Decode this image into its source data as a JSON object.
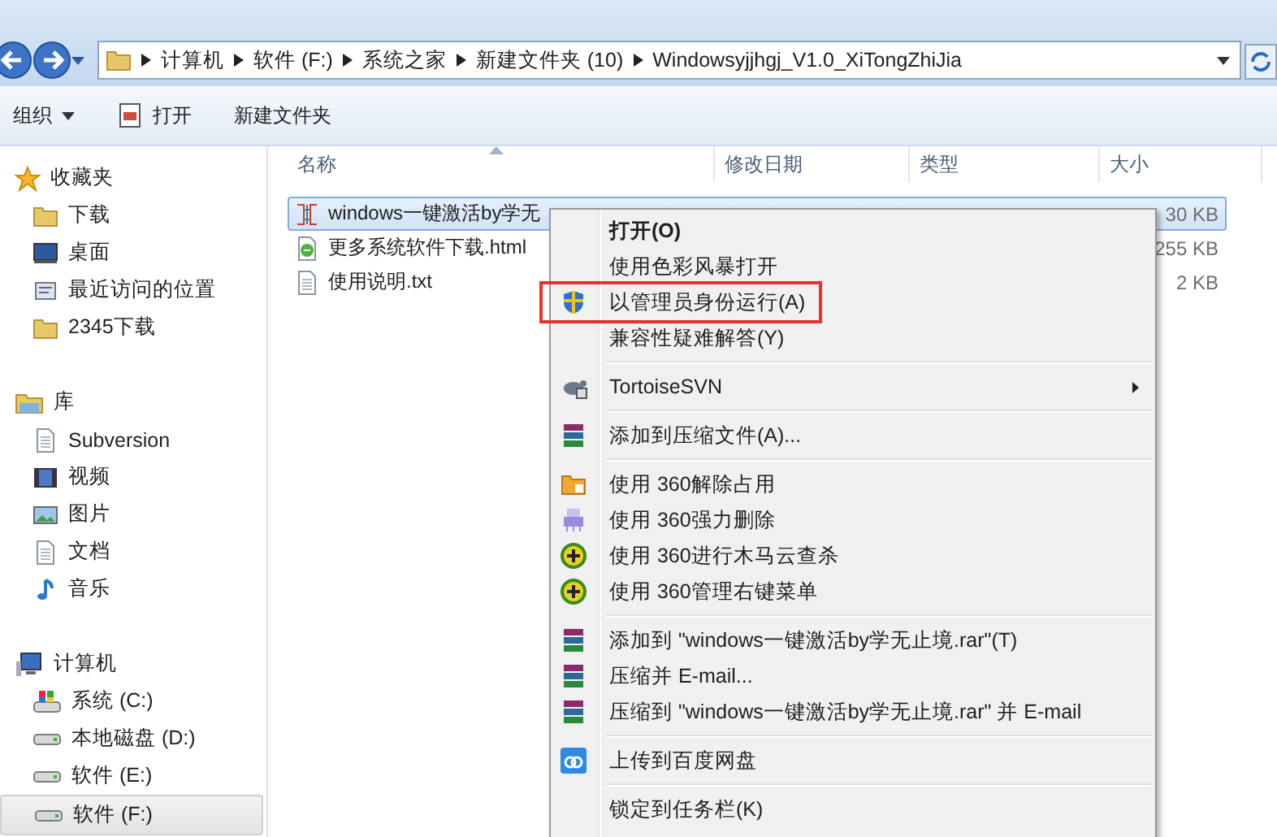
{
  "nav": {
    "breadcrumb": [
      "计算机",
      "软件 (F:)",
      "系统之家",
      "新建文件夹 (10)",
      "Windowsyjjhgj_V1.0_XiTongZhiJia"
    ]
  },
  "toolbar": [
    {
      "label": "组织",
      "kind": "dropdown"
    },
    {
      "label": "打开",
      "kind": "icon"
    },
    {
      "label": "新建文件夹",
      "kind": "plain"
    }
  ],
  "sidebar": {
    "groups": [
      {
        "label": "收藏夹",
        "items": [
          {
            "label": "下载",
            "selected": false
          },
          {
            "label": "桌面",
            "selected": false
          },
          {
            "label": "最近访问的位置",
            "selected": false
          },
          {
            "label": "2345下载",
            "selected": false
          }
        ]
      },
      {
        "label": "库",
        "items": [
          {
            "label": "Subversion",
            "selected": false
          },
          {
            "label": "视频",
            "selected": false
          },
          {
            "label": "图片",
            "selected": false
          },
          {
            "label": "文档",
            "selected": false
          },
          {
            "label": "音乐",
            "selected": false
          }
        ]
      },
      {
        "label": "计算机",
        "items": [
          {
            "label": "系统 (C:)",
            "selected": false
          },
          {
            "label": "本地磁盘 (D:)",
            "selected": false
          },
          {
            "label": "软件 (E:)",
            "selected": false
          },
          {
            "label": "软件 (F:)",
            "selected": true
          }
        ]
      }
    ]
  },
  "columns": [
    "名称",
    "修改日期",
    "类型",
    "大小"
  ],
  "files": [
    {
      "name": "windows一键激活by学无",
      "size": "30 KB",
      "selected": true
    },
    {
      "name": "更多系统软件下载.html",
      "size": "255 KB",
      "selected": false
    },
    {
      "name": "使用说明.txt",
      "size": "2 KB",
      "selected": false
    }
  ],
  "context_menu": {
    "items": [
      {
        "kind": "item",
        "label": "打开(O)",
        "default": true,
        "highlighted": false
      },
      {
        "kind": "item",
        "label": "使用色彩风暴打开",
        "default": false,
        "highlighted": false
      },
      {
        "kind": "item",
        "label": "以管理员身份运行(A)",
        "default": false,
        "highlighted": true
      },
      {
        "kind": "item",
        "label": "兼容性疑难解答(Y)",
        "default": false,
        "highlighted": false
      },
      {
        "kind": "separator"
      },
      {
        "kind": "submenu",
        "label": "TortoiseSVN",
        "default": false,
        "highlighted": false
      },
      {
        "kind": "separator"
      },
      {
        "kind": "item",
        "label": "添加到压缩文件(A)...",
        "default": false,
        "highlighted": false
      },
      {
        "kind": "separator"
      },
      {
        "kind": "item",
        "label": "使用 360解除占用",
        "default": false,
        "highlighted": false
      },
      {
        "kind": "item",
        "label": "使用 360强力删除",
        "default": false,
        "highlighted": false
      },
      {
        "kind": "item",
        "label": "使用 360进行木马云查杀",
        "default": false,
        "highlighted": false
      },
      {
        "kind": "item",
        "label": "使用 360管理右键菜单",
        "default": false,
        "highlighted": false
      },
      {
        "kind": "separator"
      },
      {
        "kind": "item",
        "label": "添加到 \"windows一键激活by学无止境.rar\"(T)",
        "default": false,
        "highlighted": false
      },
      {
        "kind": "item",
        "label": "压缩并 E-mail...",
        "default": false,
        "highlighted": false
      },
      {
        "kind": "item",
        "label": "压缩到 \"windows一键激活by学无止境.rar\" 并 E-mail",
        "default": false,
        "highlighted": false
      },
      {
        "kind": "separator"
      },
      {
        "kind": "item",
        "label": "上传到百度网盘",
        "default": false,
        "highlighted": false
      },
      {
        "kind": "separator"
      },
      {
        "kind": "item",
        "label": "锁定到任务栏(K)",
        "default": false,
        "highlighted": false
      }
    ]
  }
}
